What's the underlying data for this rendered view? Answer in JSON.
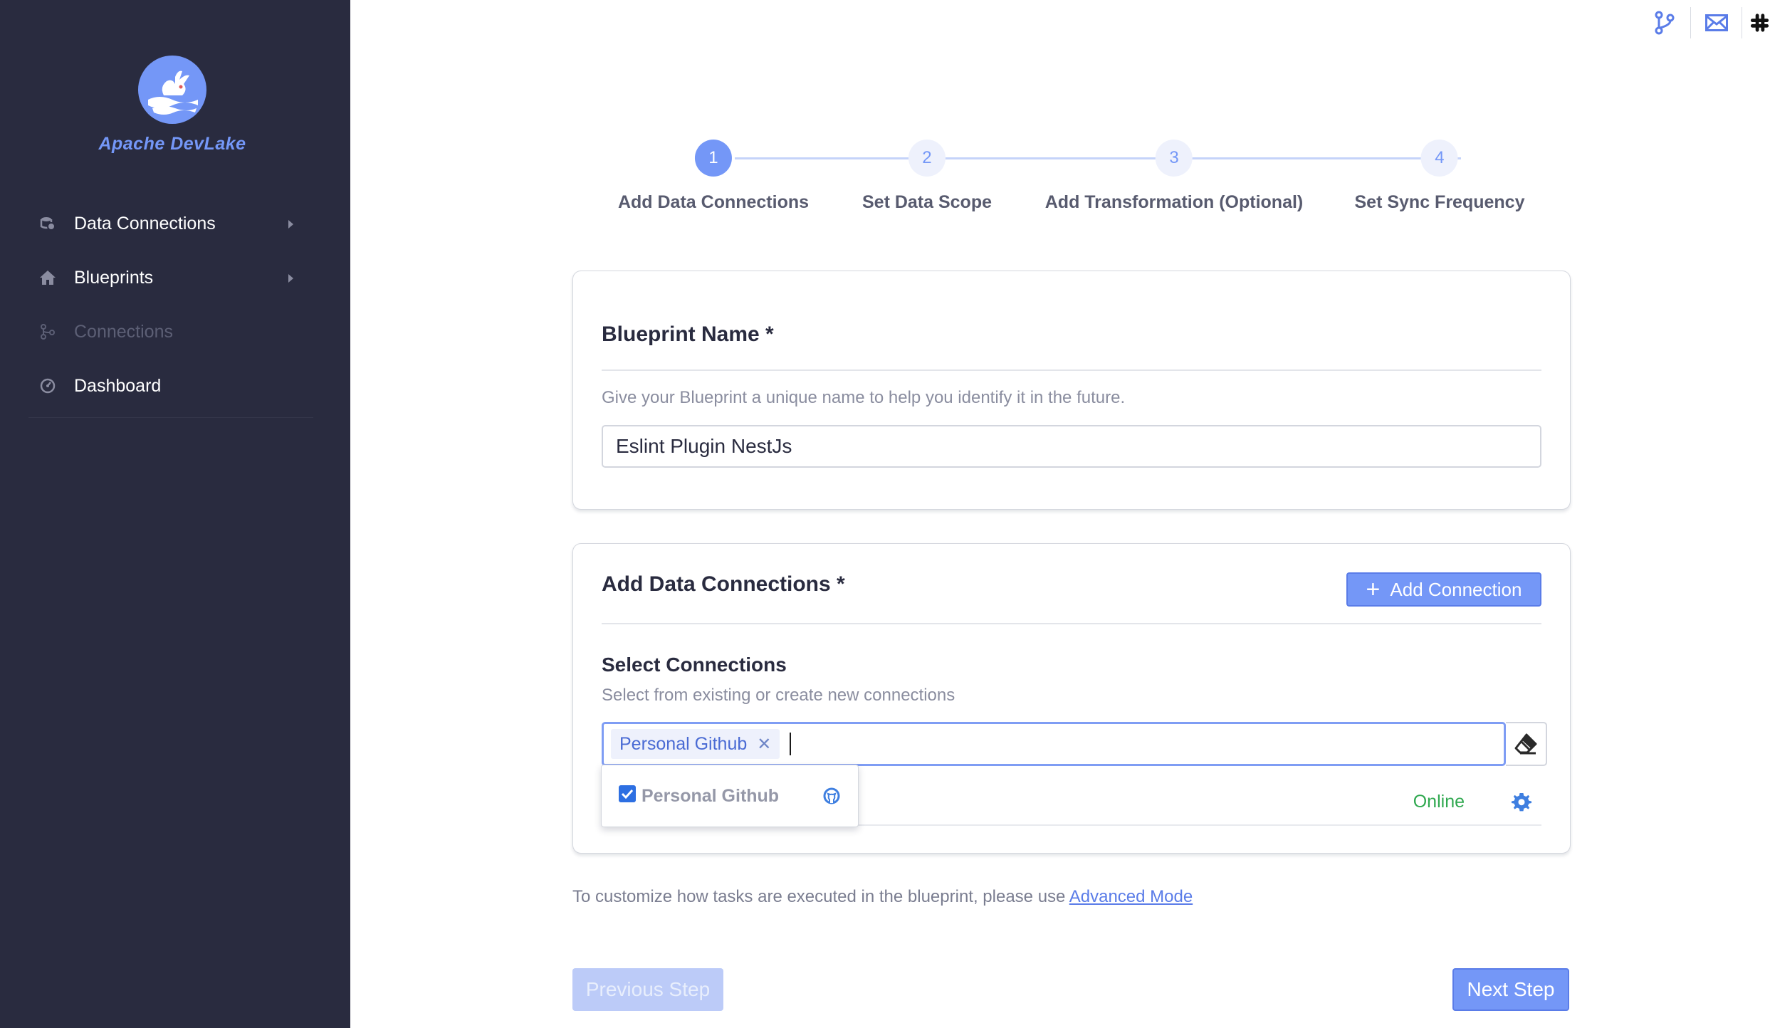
{
  "app": {
    "name": "Apache DevLake"
  },
  "sidebar": {
    "items": [
      {
        "label": "Data Connections",
        "icon": "database-icon",
        "expandable": true,
        "disabled": false
      },
      {
        "label": "Blueprints",
        "icon": "home-icon",
        "expandable": true,
        "disabled": false
      },
      {
        "label": "Connections",
        "icon": "git-branch-icon",
        "expandable": false,
        "disabled": true
      },
      {
        "label": "Dashboard",
        "icon": "dashboard-icon",
        "expandable": false,
        "disabled": false
      }
    ]
  },
  "header_icons": [
    "git-branch-icon",
    "mail-icon",
    "slack-icon"
  ],
  "stepper": {
    "active_step": 1,
    "steps": [
      {
        "number": "1",
        "label": "Add Data Connections"
      },
      {
        "number": "2",
        "label": "Set Data Scope"
      },
      {
        "number": "3",
        "label": "Add Transformation (Optional)"
      },
      {
        "number": "4",
        "label": "Set Sync Frequency"
      }
    ]
  },
  "blueprint_name": {
    "title": "Blueprint Name *",
    "helper": "Give your Blueprint a unique name to help you identify it in the future.",
    "value": "Eslint Plugin NestJs"
  },
  "data_connections": {
    "title": "Add Data Connections *",
    "add_button_label": "Add Connection",
    "select_title": "Select Connections",
    "select_helper": "Select from existing or create new connections",
    "selected_tags": [
      "Personal Github"
    ],
    "dropdown_options": [
      {
        "label": "Personal Github",
        "checked": true,
        "icon": "github-icon"
      }
    ],
    "connection_status": "Online"
  },
  "footnote": {
    "text": "To customize how tasks are executed in the blueprint, please use ",
    "link": "Advanced Mode"
  },
  "footer": {
    "prev_label": "Previous Step",
    "next_label": "Next Step"
  },
  "colors": {
    "sidebar_bg": "#292b3f",
    "accent": "#7497f7",
    "online": "#2fa84f"
  }
}
